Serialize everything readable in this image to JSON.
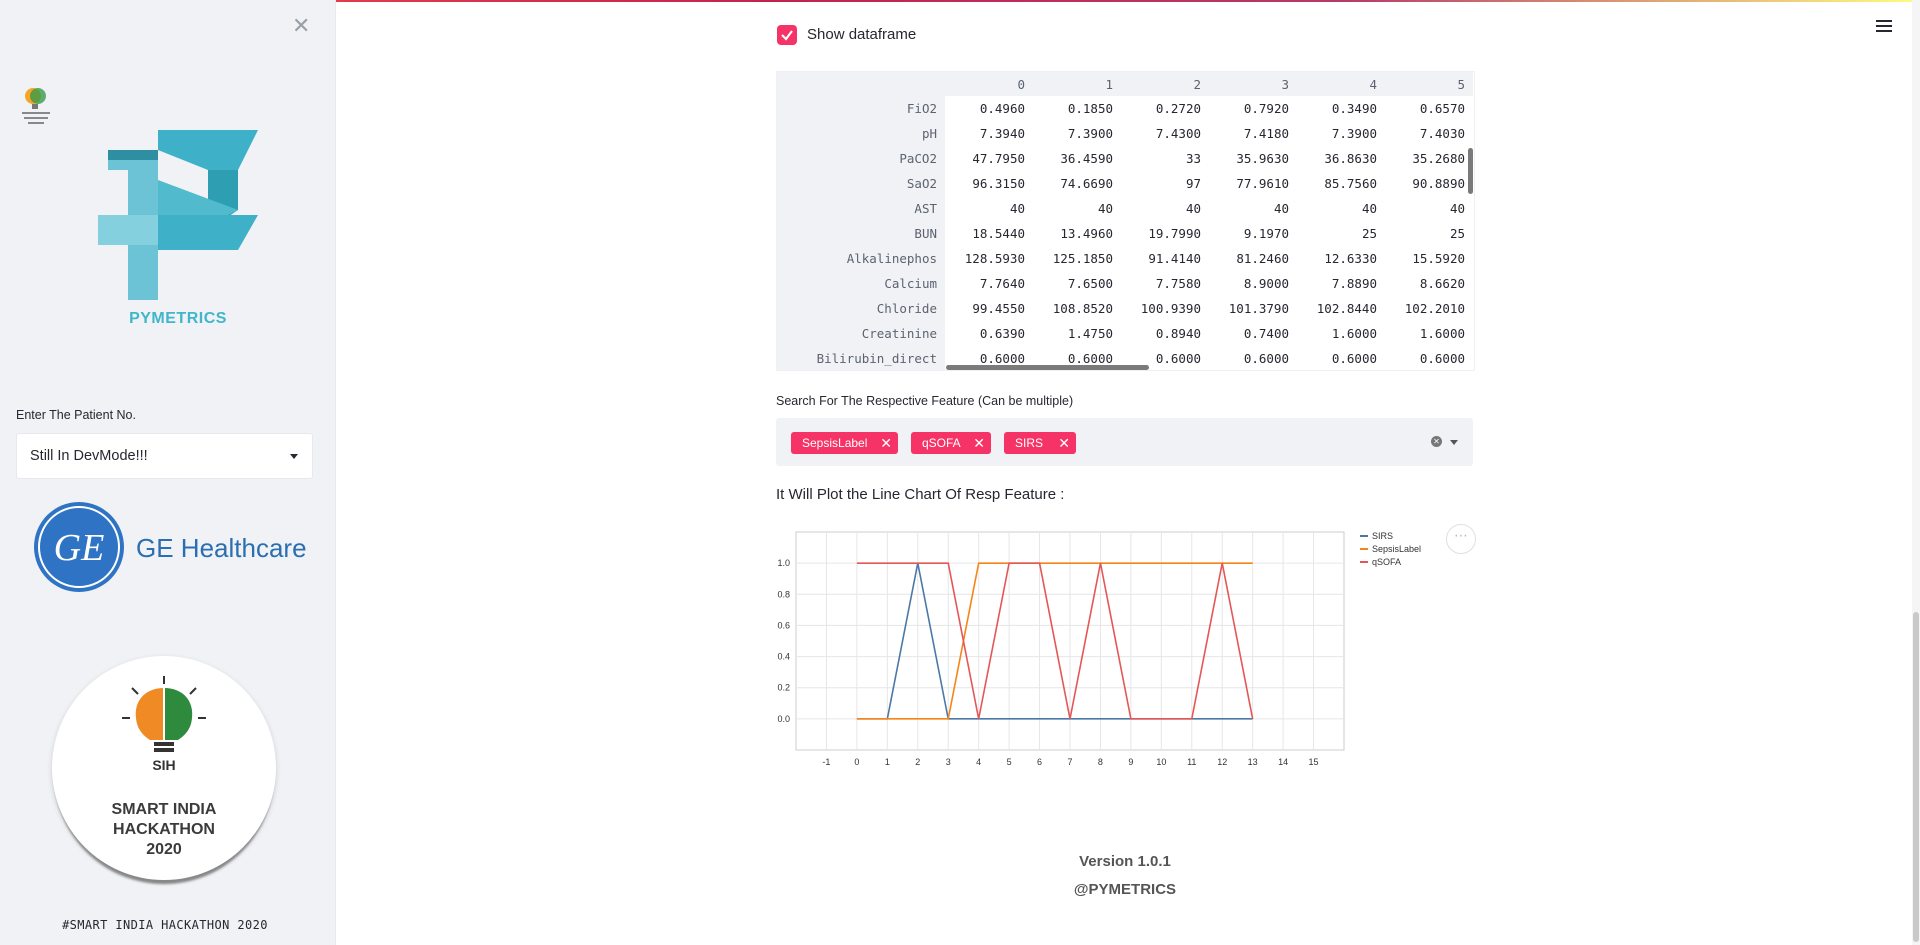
{
  "sidebar": {
    "close_icon": "close-icon",
    "brand_text": "PYMETRICS",
    "patient_label": "Enter The Patient No.",
    "patient_select_value": "Still In DevMode!!!",
    "ge_text": "GE Healthcare",
    "sih_line1": "SMART INDIA",
    "sih_line2": "HACKATHON",
    "sih_line3": "2020",
    "sih_badge": "SIH",
    "footer": "#SMART INDIA HACKATHON 2020"
  },
  "main": {
    "checkbox_label": "Show dataframe",
    "dataframe": {
      "columns": [
        "0",
        "1",
        "2",
        "3",
        "4",
        "5"
      ],
      "rows": [
        {
          "label": "FiO2",
          "values": [
            "0.4960",
            "0.1850",
            "0.2720",
            "0.7920",
            "0.3490",
            "0.6570"
          ]
        },
        {
          "label": "pH",
          "values": [
            "7.3940",
            "7.3900",
            "7.4300",
            "7.4180",
            "7.3900",
            "7.4030"
          ]
        },
        {
          "label": "PaCO2",
          "values": [
            "47.7950",
            "36.4590",
            "33",
            "35.9630",
            "36.8630",
            "35.2680"
          ]
        },
        {
          "label": "SaO2",
          "values": [
            "96.3150",
            "74.6690",
            "97",
            "77.9610",
            "85.7560",
            "90.8890"
          ]
        },
        {
          "label": "AST",
          "values": [
            "40",
            "40",
            "40",
            "40",
            "40",
            "40"
          ]
        },
        {
          "label": "BUN",
          "values": [
            "18.5440",
            "13.4960",
            "19.7990",
            "9.1970",
            "25",
            "25"
          ]
        },
        {
          "label": "Alkalinephos",
          "values": [
            "128.5930",
            "125.1850",
            "91.4140",
            "81.2460",
            "12.6330",
            "15.5920"
          ]
        },
        {
          "label": "Calcium",
          "values": [
            "7.7640",
            "7.6500",
            "7.7580",
            "8.9000",
            "7.8890",
            "8.6620"
          ]
        },
        {
          "label": "Chloride",
          "values": [
            "99.4550",
            "108.8520",
            "100.9390",
            "101.3790",
            "102.8440",
            "102.2010"
          ]
        },
        {
          "label": "Creatinine",
          "values": [
            "0.6390",
            "1.4750",
            "0.8940",
            "0.7400",
            "1.6000",
            "1.6000"
          ]
        },
        {
          "label": "Bilirubin_direct",
          "values": [
            "0.6000",
            "0.6000",
            "0.6000",
            "0.6000",
            "0.6000",
            "0.6000"
          ]
        }
      ]
    },
    "multiselect_label": "Search For The Respective Feature (Can be multiple)",
    "tags": [
      "SepsisLabel",
      "qSOFA",
      "SIRS"
    ],
    "plot_heading": "It Will Plot the Line Chart Of Resp Feature :",
    "version": "Version 1.0.1",
    "handle": "@PYMETRICS"
  },
  "colors": {
    "accent": "#f63366",
    "sirs": "#4c78a8",
    "sepsis": "#f58518",
    "qsofa": "#e45756"
  },
  "chart_data": {
    "type": "line",
    "x": [
      0,
      1,
      2,
      3,
      4,
      5,
      6,
      7,
      8,
      9,
      10,
      11,
      12,
      13
    ],
    "series": [
      {
        "name": "SIRS",
        "color": "#4c78a8",
        "values": [
          0,
          0,
          1,
          0,
          0,
          0,
          0,
          0,
          0,
          0,
          0,
          0,
          0,
          0
        ]
      },
      {
        "name": "SepsisLabel",
        "color": "#f58518",
        "values": [
          0,
          0,
          0,
          0,
          1,
          1,
          1,
          1,
          1,
          1,
          1,
          1,
          1,
          1
        ]
      },
      {
        "name": "qSOFA",
        "color": "#e45756",
        "values": [
          1,
          1,
          1,
          1,
          0,
          1,
          1,
          0,
          1,
          0,
          0,
          0,
          1,
          0
        ]
      }
    ],
    "xlim": [
      -2,
      16
    ],
    "ylim": [
      -0.2,
      1.2
    ],
    "xticks": [
      -1,
      0,
      1,
      2,
      3,
      4,
      5,
      6,
      7,
      8,
      9,
      10,
      11,
      12,
      13,
      14,
      15
    ],
    "yticks": [
      0,
      0.2,
      0.4,
      0.6,
      0.8,
      1
    ],
    "ytick_labels": [
      "0.0",
      "0.2",
      "0.4",
      "0.6",
      "0.8",
      "1.0"
    ],
    "grid": true,
    "legend": "top-right"
  }
}
